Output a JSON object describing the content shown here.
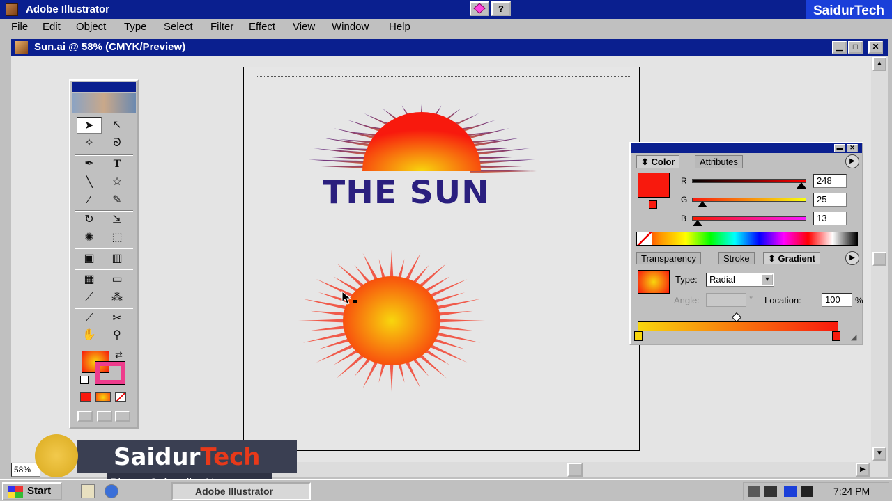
{
  "app": {
    "title": "Adobe Illustrator",
    "brand": "SaidurTech"
  },
  "menu": [
    "File",
    "Edit",
    "Object",
    "Type",
    "Select",
    "Filter",
    "Effect",
    "View",
    "Window",
    "Help"
  ],
  "document": {
    "title": "Sun.ai @ 58% (CMYK/Preview)",
    "zoom": "58%",
    "artwork_title": "THE SUN"
  },
  "window_buttons": {
    "minimize": "▁",
    "maximize": "□",
    "close": "✕",
    "help": "?"
  },
  "color_panel": {
    "tabs": [
      "Color",
      "Attributes"
    ],
    "channels": [
      {
        "label": "R",
        "value": "248",
        "fraction": 0.97
      },
      {
        "label": "G",
        "value": "25",
        "fraction": 0.1
      },
      {
        "label": "B",
        "value": "13",
        "fraction": 0.05
      }
    ],
    "fill_color": "#f8190d"
  },
  "gradient_panel": {
    "tabs": [
      "Transparency",
      "Stroke",
      "Gradient"
    ],
    "type_label": "Type:",
    "type_value": "Radial",
    "angle_label": "Angle:",
    "angle_unit": "°",
    "location_label": "Location:",
    "location_value": "100",
    "location_unit": "%",
    "start_color": "#f8d60d",
    "end_color": "#f8190d"
  },
  "promo": {
    "name_part1": "Saidur",
    "name_part2": "Tech",
    "subtitle": "Please Subscribe Now"
  },
  "taskbar": {
    "start": "Start",
    "task": "Adobe Illustrator",
    "clock": "7:24 PM"
  }
}
